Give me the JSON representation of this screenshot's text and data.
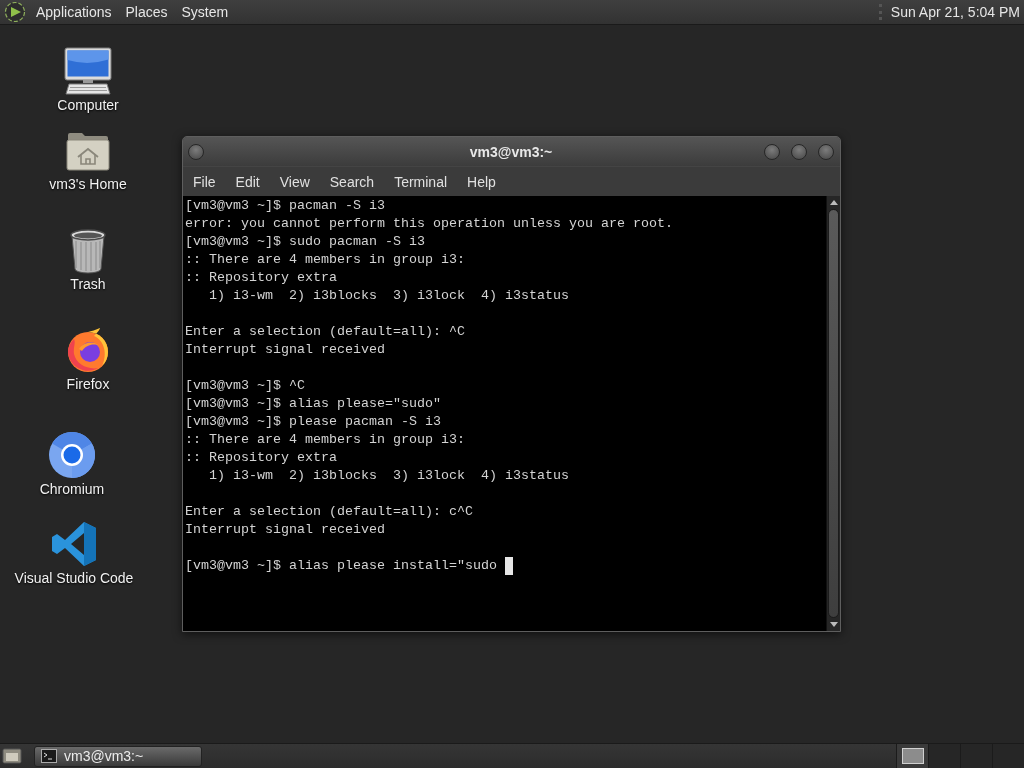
{
  "top_panel": {
    "menus": [
      "Applications",
      "Places",
      "System"
    ],
    "clock": "Sun Apr 21, 5:04 PM"
  },
  "desktop_icons": [
    {
      "label": "Computer",
      "kind": "computer"
    },
    {
      "label": "vm3's Home",
      "kind": "home"
    },
    {
      "label": "Trash",
      "kind": "trash"
    },
    {
      "label": "Firefox",
      "kind": "firefox"
    },
    {
      "label": "Chromium",
      "kind": "chromium"
    },
    {
      "label": "Visual Studio Code",
      "kind": "vscode"
    }
  ],
  "terminal_window": {
    "title": "vm3@vm3:~",
    "menu": [
      "File",
      "Edit",
      "View",
      "Search",
      "Terminal",
      "Help"
    ],
    "output_blocks": [
      [
        "[vm3@vm3 ~]$ pacman -S i3",
        "error: you cannot perform this operation unless you are root.",
        "[vm3@vm3 ~]$ sudo pacman -S i3",
        ":: There are 4 members in group i3:",
        ":: Repository extra",
        "   1) i3-wm  2) i3blocks  3) i3lock  4) i3status"
      ],
      [
        "Enter a selection (default=all): ^C",
        "Interrupt signal received"
      ],
      [
        "[vm3@vm3 ~]$ ^C",
        "[vm3@vm3 ~]$ alias please=\"sudo\"",
        "[vm3@vm3 ~]$ please pacman -S i3",
        ":: There are 4 members in group i3:",
        ":: Repository extra",
        "   1) i3-wm  2) i3blocks  3) i3lock  4) i3status"
      ],
      [
        "Enter a selection (default=all): c^C",
        "Interrupt signal received"
      ],
      [
        "[vm3@vm3 ~]$ alias please install=\"sudo"
      ]
    ],
    "cursor": true
  },
  "bottom_panel": {
    "tasks": [
      {
        "label": "vm3@vm3:~",
        "selected": true
      }
    ],
    "workspaces": [
      {
        "selected": true,
        "has_window": true
      },
      {
        "selected": false,
        "has_window": false
      },
      {
        "selected": false,
        "has_window": false
      },
      {
        "selected": false,
        "has_window": false
      }
    ]
  }
}
